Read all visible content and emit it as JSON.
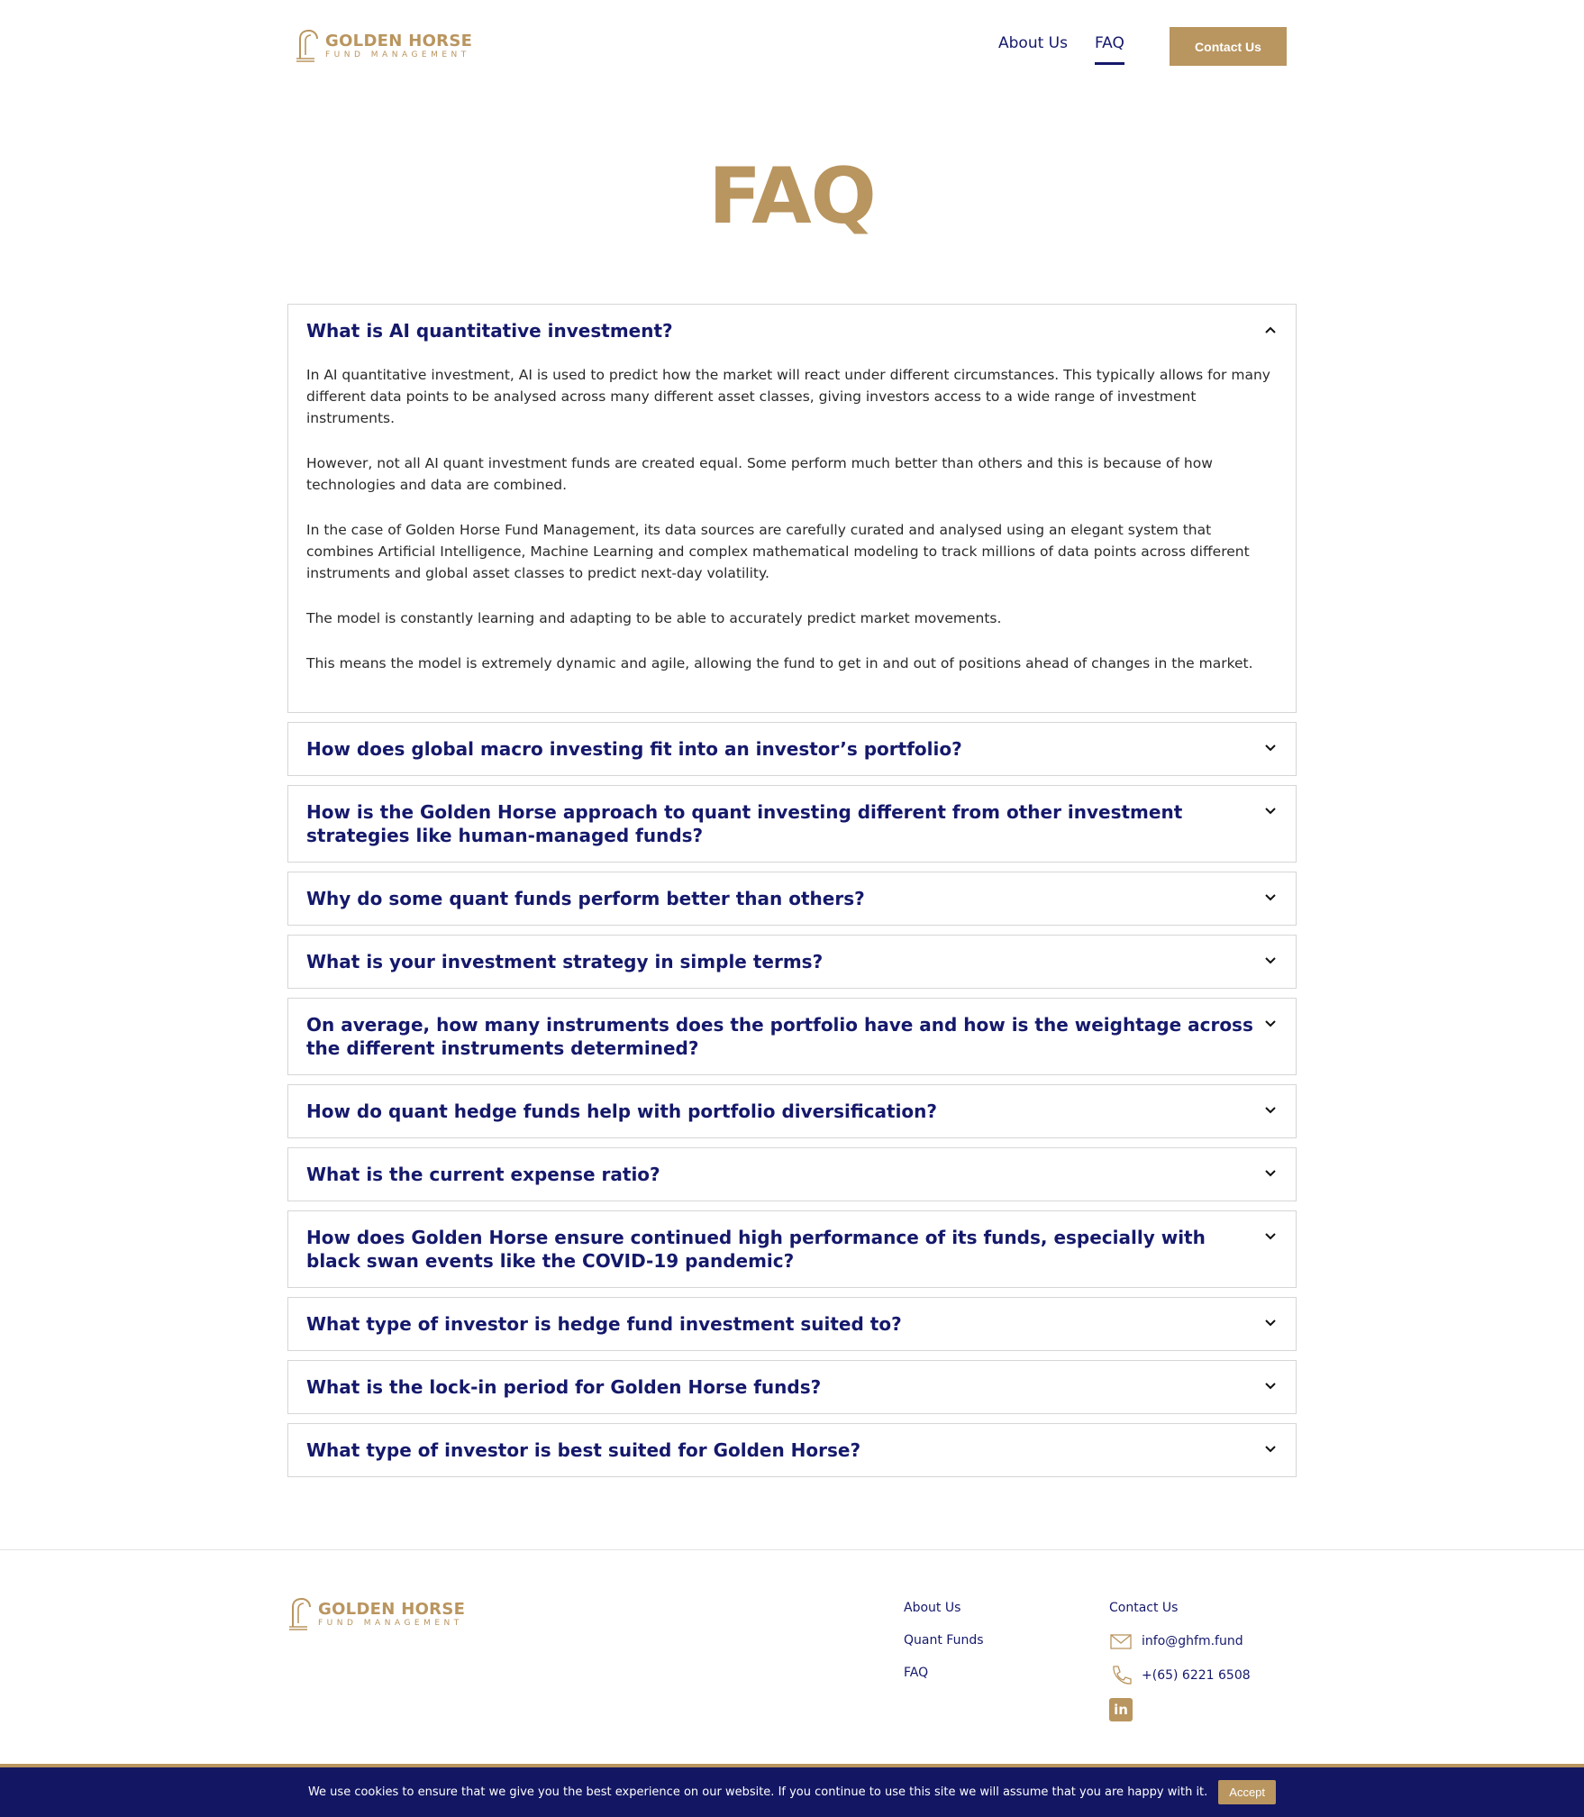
{
  "brand": {
    "name": "GOLDEN HORSE",
    "sub": "FUND MANAGEMENT"
  },
  "nav": {
    "about": "About Us",
    "faq": "FAQ",
    "contact": "Contact Us"
  },
  "page": {
    "title": "FAQ"
  },
  "faq": {
    "open_question": "What is AI quantitative investment?",
    "answer": [
      "In AI quantitative investment, AI is used to predict how the market will react under different circumstances. This typically allows for many different data points to be analysed across many different asset classes, giving investors access to a wide range of investment instruments.",
      "However, not all AI quant investment funds are created equal. Some perform much better than others and this is because of how technologies and data are combined.",
      "In the case of Golden Horse Fund Management, its data sources are carefully curated and analysed using an elegant system that combines Artificial Intelligence, Machine Learning and complex mathematical modeling to track millions of data points across different instruments and global asset classes to predict next-day volatility.",
      "The model is constantly learning and adapting to be able to accurately predict market movements.",
      "This means the model is extremely dynamic and agile, allowing the fund to get in and out of positions ahead of changes in the market."
    ],
    "items": [
      "How does global macro investing fit into an investor’s portfolio?",
      "How is the Golden Horse approach to quant investing different from other investment strategies like human-managed funds?",
      "Why do some quant funds perform better than others?",
      "What is your investment strategy in simple terms?",
      "On average, how many instruments does the portfolio have and how is the weightage across the different instruments determined?",
      "How do quant hedge funds help with portfolio diversification?",
      "What is the current expense ratio?",
      "How does Golden Horse ensure continued high performance of its funds, especially with black swan events like the COVID-19 pandemic?",
      "What type of investor is hedge fund investment suited to?",
      "What is the lock-in period for Golden Horse funds?",
      "What type of investor is best suited for Golden Horse?"
    ]
  },
  "footer": {
    "links": [
      "About Us",
      "Quant Funds",
      "FAQ"
    ],
    "contact_heading": "Contact Us",
    "email": "info@ghfm.fund",
    "phone": "+(65) 6221 6508",
    "linkedin_icon": "linkedin-icon"
  },
  "cookie": {
    "message": "We use cookies to ensure that we give you the best experience on our website. If you continue to use this site we will assume that you are happy with it.",
    "accept": "Accept"
  },
  "colors": {
    "gold": "#b9955f",
    "navy": "#15196b",
    "cookie_bg": "#121663"
  }
}
